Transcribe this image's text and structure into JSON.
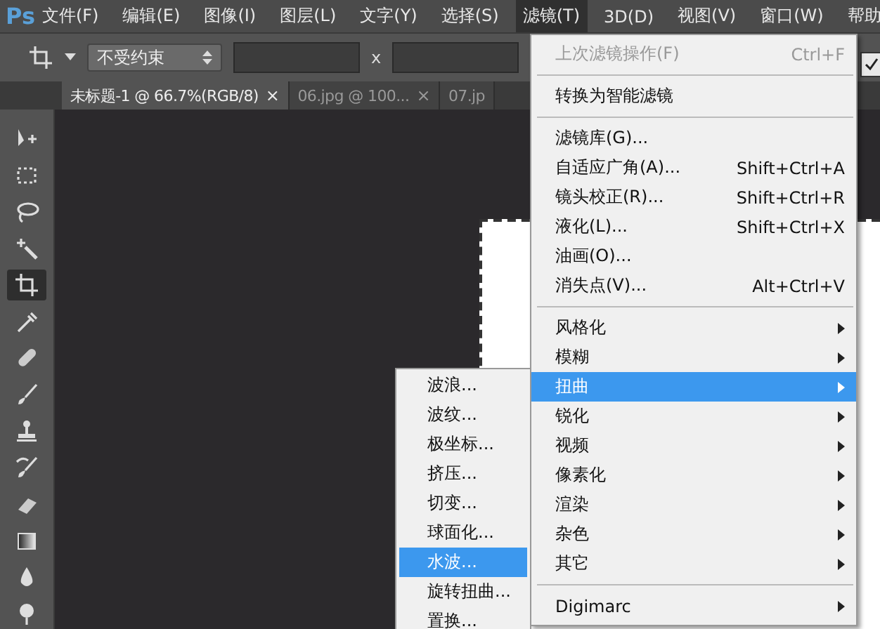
{
  "menu_bar": {
    "logo": "Ps",
    "items": [
      {
        "label": "文件(F)",
        "selected": false
      },
      {
        "label": "编辑(E)",
        "selected": false
      },
      {
        "label": "图像(I)",
        "selected": false
      },
      {
        "label": "图层(L)",
        "selected": false
      },
      {
        "label": "文字(Y)",
        "selected": false
      },
      {
        "label": "选择(S)",
        "selected": false
      },
      {
        "label": "滤镜(T)",
        "selected": true
      },
      {
        "label": "3D(D)",
        "selected": false
      },
      {
        "label": "视图(V)",
        "selected": false
      },
      {
        "label": "窗口(W)",
        "selected": false
      },
      {
        "label": "帮助",
        "selected": false
      }
    ]
  },
  "options_bar": {
    "ratio_select": "不受约束",
    "separator": "x",
    "checkbox_checked": true
  },
  "tabs": [
    {
      "label": "未标题-1 @ 66.7%(RGB/8)",
      "close": "×",
      "selected": true
    },
    {
      "label": "06.jpg @ 100...",
      "close": "×",
      "selected": false
    },
    {
      "label": "07.jp",
      "selected": false
    }
  ],
  "tools": [
    {
      "kind": "move",
      "selected": false
    },
    {
      "kind": "marquee",
      "selected": false
    },
    {
      "kind": "lasso",
      "selected": false
    },
    {
      "kind": "wand",
      "selected": false
    },
    {
      "kind": "crop",
      "selected": true
    },
    {
      "kind": "eyedropper",
      "selected": false
    },
    {
      "kind": "bandage",
      "selected": false
    },
    {
      "kind": "brush",
      "selected": false
    },
    {
      "kind": "stamp",
      "selected": false
    },
    {
      "kind": "history",
      "selected": false
    },
    {
      "kind": "eraser",
      "selected": false
    },
    {
      "kind": "gradient",
      "selected": false
    },
    {
      "kind": "drop",
      "selected": false
    },
    {
      "kind": "dodge",
      "selected": false
    }
  ],
  "filter_menu": [
    {
      "kind": "item",
      "label": "上次滤镜操作(F)",
      "shortcut": "Ctrl+F",
      "disabled": true,
      "selected": false
    },
    {
      "kind": "separator"
    },
    {
      "kind": "item",
      "label": "转换为智能滤镜",
      "disabled": false,
      "selected": false
    },
    {
      "kind": "separator"
    },
    {
      "kind": "item",
      "label": "滤镜库(G)...",
      "disabled": false,
      "selected": false
    },
    {
      "kind": "item",
      "label": "自适应广角(A)...",
      "shortcut": "Shift+Ctrl+A",
      "disabled": false,
      "selected": false
    },
    {
      "kind": "item",
      "label": "镜头校正(R)...",
      "shortcut": "Shift+Ctrl+R",
      "disabled": false,
      "selected": false
    },
    {
      "kind": "item",
      "label": "液化(L)...",
      "shortcut": "Shift+Ctrl+X",
      "disabled": false,
      "selected": false
    },
    {
      "kind": "item",
      "label": "油画(O)...",
      "disabled": false,
      "selected": false
    },
    {
      "kind": "item",
      "label": "消失点(V)...",
      "shortcut": "Alt+Ctrl+V",
      "disabled": false,
      "selected": false
    },
    {
      "kind": "separator"
    },
    {
      "kind": "submenu",
      "label": "风格化",
      "disabled": false,
      "selected": false
    },
    {
      "kind": "submenu",
      "label": "模糊",
      "disabled": false,
      "selected": false
    },
    {
      "kind": "submenu",
      "label": "扭曲",
      "disabled": false,
      "selected": true
    },
    {
      "kind": "submenu",
      "label": "锐化",
      "disabled": false,
      "selected": false
    },
    {
      "kind": "submenu",
      "label": "视频",
      "disabled": false,
      "selected": false
    },
    {
      "kind": "submenu",
      "label": "像素化",
      "disabled": false,
      "selected": false
    },
    {
      "kind": "submenu",
      "label": "渲染",
      "disabled": false,
      "selected": false
    },
    {
      "kind": "submenu",
      "label": "杂色",
      "disabled": false,
      "selected": false
    },
    {
      "kind": "submenu",
      "label": "其它",
      "disabled": false,
      "selected": false
    },
    {
      "kind": "separator"
    },
    {
      "kind": "submenu",
      "label": "Digimarc",
      "disabled": false,
      "selected": false
    }
  ],
  "distort_submenu": [
    {
      "label": "波浪...",
      "selected": false
    },
    {
      "label": "波纹...",
      "selected": false
    },
    {
      "label": "极坐标...",
      "selected": false
    },
    {
      "label": "挤压...",
      "selected": false
    },
    {
      "label": "切变...",
      "selected": false
    },
    {
      "label": "球面化...",
      "selected": false
    },
    {
      "label": "水波...",
      "selected": true
    },
    {
      "label": "旋转扭曲...",
      "selected": false
    },
    {
      "label": "置换...",
      "selected": false
    }
  ]
}
